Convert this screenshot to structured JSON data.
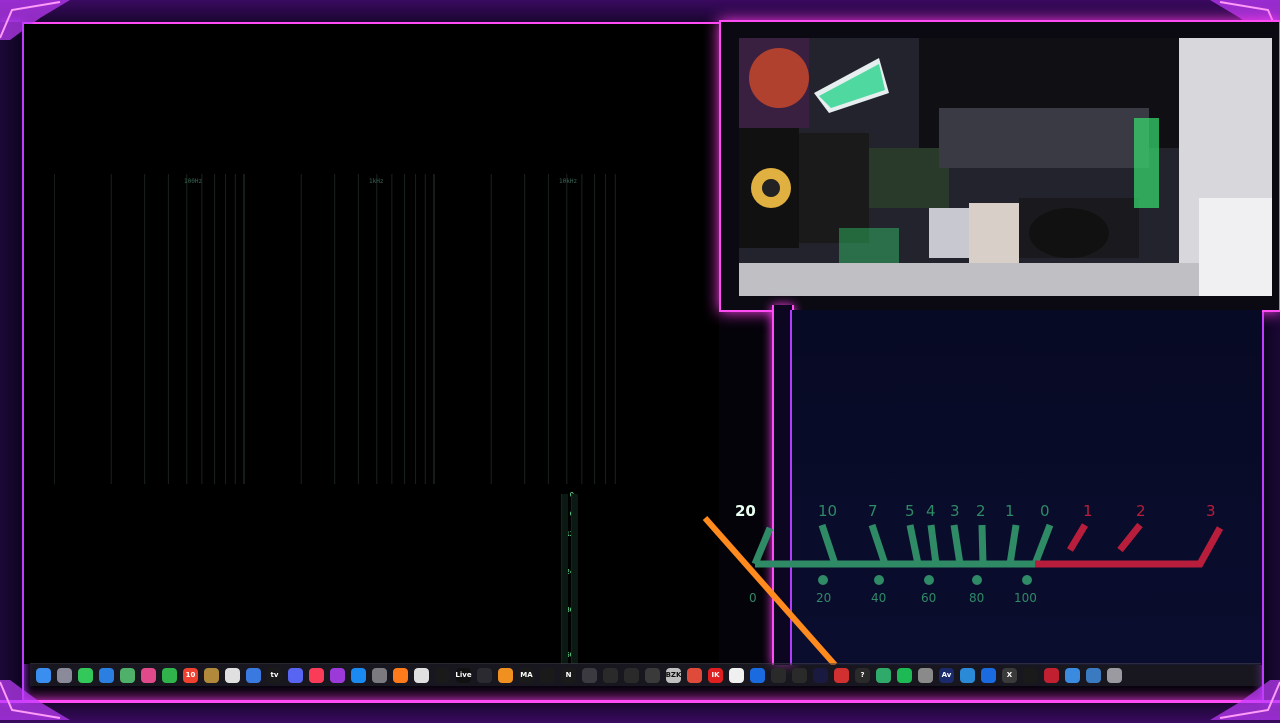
{
  "spectrum": {
    "freq_labels": [
      "100Hz",
      "1kHz",
      "10kHz"
    ]
  },
  "level_meter": {
    "db_ticks": [
      "0",
      "6",
      "12",
      "24",
      "36",
      "50"
    ]
  },
  "vu_meter": {
    "top_scale": [
      "20",
      "10",
      "7",
      "5",
      "4",
      "3",
      "2",
      "1",
      "0",
      "1",
      "2",
      "3"
    ],
    "bottom_scale": [
      "0",
      "20",
      "40",
      "60",
      "80",
      "100"
    ],
    "colors": {
      "green": "#2f8a66",
      "red": "#b81e3c",
      "needle": "#ff8a1e"
    }
  },
  "dock": {
    "icons": [
      {
        "name": "finder-icon",
        "label": "",
        "color": "#3a8ef0"
      },
      {
        "name": "launchpad-icon",
        "label": "",
        "color": "#8a8a9a"
      },
      {
        "name": "messages-icon",
        "label": "",
        "color": "#34c759"
      },
      {
        "name": "mail-icon",
        "label": "",
        "color": "#2b7fe0"
      },
      {
        "name": "maps-icon",
        "label": "",
        "color": "#4fb06a"
      },
      {
        "name": "photos-icon",
        "label": "",
        "color": "#e04a8a"
      },
      {
        "name": "facetime-icon",
        "label": "",
        "color": "#2fb34a"
      },
      {
        "name": "calendar-icon",
        "label": "10",
        "color": "#f04030"
      },
      {
        "name": "notes-icon",
        "label": "",
        "color": "#b08a3a"
      },
      {
        "name": "reminders-icon",
        "label": "",
        "color": "#e0e0e0"
      },
      {
        "name": "freeform-icon",
        "label": "",
        "color": "#3a7ae0"
      },
      {
        "name": "tv-icon",
        "label": "tv",
        "color": "#1a1a1a"
      },
      {
        "name": "discord-icon",
        "label": "",
        "color": "#5865f2"
      },
      {
        "name": "music-icon",
        "label": "",
        "color": "#fa3c58"
      },
      {
        "name": "podcasts-icon",
        "label": "",
        "color": "#9b3ad8"
      },
      {
        "name": "app-store-icon",
        "label": "",
        "color": "#1a8af0"
      },
      {
        "name": "settings-icon",
        "label": "",
        "color": "#7a7a80"
      },
      {
        "name": "firefox-icon",
        "label": "",
        "color": "#ff7a1a"
      },
      {
        "name": "chrome-icon",
        "label": "",
        "color": "#e0e0e0"
      },
      {
        "name": "activity-monitor-icon",
        "label": "",
        "color": "#1a1a1a"
      },
      {
        "name": "live-icon",
        "label": "Live",
        "color": "#111111"
      },
      {
        "name": "obs-icon",
        "label": "",
        "color": "#2a2a30"
      },
      {
        "name": "fl-studio-icon",
        "label": "",
        "color": "#f09020"
      },
      {
        "name": "ma-icon",
        "label": "MA",
        "color": "#1a1a1a"
      },
      {
        "name": "capcut-icon",
        "label": "",
        "color": "#1a1a1a"
      },
      {
        "name": "native-instruments-icon",
        "label": "N",
        "color": "#1a1a1a"
      },
      {
        "name": "synth-icon",
        "label": "",
        "color": "#3a3a40"
      },
      {
        "name": "headphones-icon",
        "label": "",
        "color": "#2a2a2a"
      },
      {
        "name": "ozone-icon",
        "label": "",
        "color": "#2a2a2a"
      },
      {
        "name": "izotope-icon",
        "label": "",
        "color": "#3a3a3a"
      },
      {
        "name": "bz-icon",
        "label": "BZK",
        "color": "#c0c0c0"
      },
      {
        "name": "waveform-icon",
        "label": "",
        "color": "#e04a3a"
      },
      {
        "name": "ik-icon",
        "label": "IK",
        "color": "#e02020"
      },
      {
        "name": "notion-icon",
        "label": "",
        "color": "#f0f0f0"
      },
      {
        "name": "waves-icon",
        "label": "",
        "color": "#1a6ae0"
      },
      {
        "name": "spatial-icon",
        "label": "",
        "color": "#2a2a2a"
      },
      {
        "name": "arturia-icon",
        "label": "",
        "color": "#2a2a2a"
      },
      {
        "name": "ma2-icon",
        "label": "",
        "color": "#1a1a40"
      },
      {
        "name": "melodyne-icon",
        "label": "",
        "color": "#d03030"
      },
      {
        "name": "help-icon",
        "label": "?",
        "color": "#2a2a2a"
      },
      {
        "name": "green-app-icon",
        "label": "",
        "color": "#2faa6a"
      },
      {
        "name": "spotify-icon",
        "label": "",
        "color": "#1db954"
      },
      {
        "name": "window-icon",
        "label": "",
        "color": "#8a8a8a"
      },
      {
        "name": "av-icon",
        "label": "Av",
        "color": "#1a2a6a"
      },
      {
        "name": "edge-icon",
        "label": "",
        "color": "#2a8ad8"
      },
      {
        "name": "xcode-icon",
        "label": "",
        "color": "#1a6ae0"
      },
      {
        "name": "x-app-icon",
        "label": "X",
        "color": "#3a3a3a"
      },
      {
        "name": "terminal-icon",
        "label": "",
        "color": "#1a1a1a"
      },
      {
        "name": "red-app-icon",
        "label": "",
        "color": "#c02030"
      },
      {
        "name": "preview-icon",
        "label": "",
        "color": "#3a8ae0"
      },
      {
        "name": "downloads-icon",
        "label": "",
        "color": "#3a7ac0"
      },
      {
        "name": "trash-icon",
        "label": "",
        "color": "#9a9aa0"
      }
    ]
  }
}
